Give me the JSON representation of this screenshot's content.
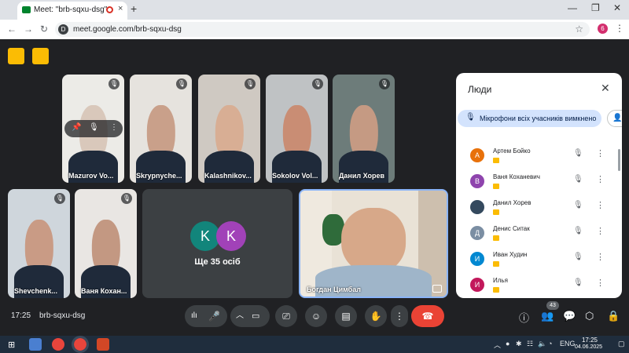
{
  "browser": {
    "tab_title": "Meet: \"brb-sqxu-dsg\"",
    "tab_close": "×",
    "new_tab": "+",
    "url": "meet.google.com/brb-sqxu-dsg",
    "profile_initial": "6",
    "window_controls": [
      "—",
      "❐",
      "✕"
    ],
    "nav": [
      "←",
      "→",
      "↻"
    ]
  },
  "participants_top": [
    {
      "name": "Mazurov Vo...",
      "skin": "#d9c8bb",
      "bg": "#ecebe7"
    },
    {
      "name": "Skrypnyche...",
      "skin": "#c9a08a",
      "bg": "#e6e3de"
    },
    {
      "name": "Kalashnikov...",
      "skin": "#d8ae94",
      "bg": "#cfc9c2"
    },
    {
      "name": "Sokolov Vol...",
      "skin": "#c98d74",
      "bg": "#bfc2c4"
    },
    {
      "name": "Данил Хорев",
      "skin": "#c59a83",
      "bg": "#6d7c7a"
    }
  ],
  "participants_bottom": [
    {
      "name": "Shevchenk...",
      "skin": "#c99b85",
      "bg": "#cfd6dc"
    },
    {
      "name": "Ваня Кохан...",
      "skin": "#c39882",
      "bg": "#e9e6e3"
    }
  ],
  "more_tile": {
    "avatars": [
      {
        "letter": "K",
        "color": "#12857b"
      },
      {
        "letter": "K",
        "color": "#a142b8"
      }
    ],
    "label": "Ще 35 осіб"
  },
  "self_tile": {
    "name": "Богдан Цимбал"
  },
  "hover_controls": [
    "📌",
    "🎙",
    "⋮"
  ],
  "meeting": {
    "time": "17:25",
    "code": "brb-sqxu-dsg",
    "participant_count": "43"
  },
  "people_panel": {
    "title": "Люди",
    "close": "✕",
    "mute_all_chip": "Мікрофони всіх учасників вимкнено",
    "people": [
      {
        "initial": "А",
        "name": "Артем Бойко",
        "color": "#e8710a"
      },
      {
        "initial": "В",
        "name": "Ваня Коханевич",
        "color": "#8e44ad"
      },
      {
        "initial": "",
        "name": "Данил Хорев",
        "color": "#34495e"
      },
      {
        "initial": "Д",
        "name": "Денис Ситак",
        "color": "#7b8ea3"
      },
      {
        "initial": "И",
        "name": "Иван Худин",
        "color": "#0288d1"
      },
      {
        "initial": "И",
        "name": "Илья",
        "color": "#c2185b"
      }
    ]
  },
  "system": {
    "clock_time": "17:25",
    "clock_date": "04.06.2025",
    "lang": "ENG"
  },
  "colors": {
    "accent": "#1a73e8",
    "end_call": "#ea4335",
    "highlight": "#fbbc04",
    "stage_bg": "#202124",
    "panel_chip": "#d3e3fd"
  }
}
